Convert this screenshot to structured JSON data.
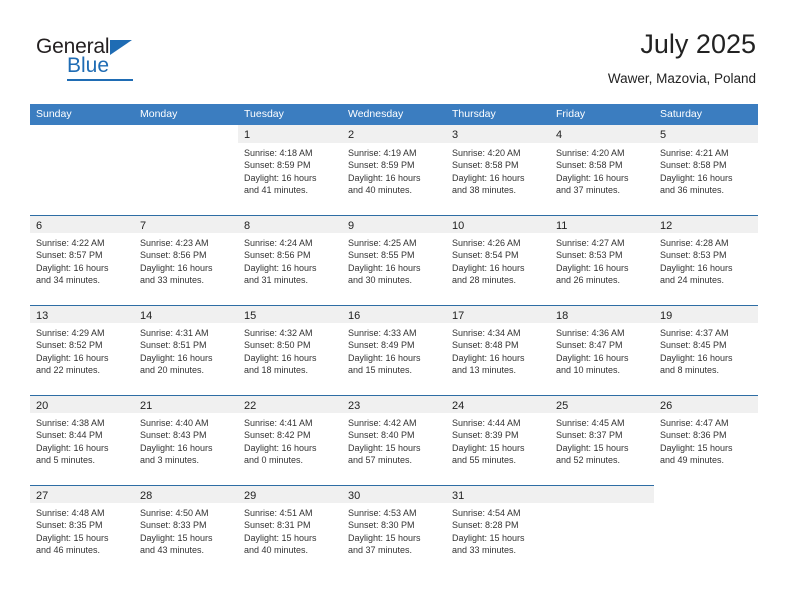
{
  "brand": {
    "line1": "General",
    "line2": "Blue",
    "triangle_color": "#1f6cb4"
  },
  "header": {
    "month_title": "July 2025",
    "location": "Wawer, Mazovia, Poland"
  },
  "theme": {
    "header_bar": "#3b7dc0",
    "row_divider": "#2e6da4",
    "num_band": "#f0f0f0",
    "text": "#333333"
  },
  "calendar": {
    "day_names": [
      "Sunday",
      "Monday",
      "Tuesday",
      "Wednesday",
      "Thursday",
      "Friday",
      "Saturday"
    ],
    "weeks": [
      [
        {
          "day": "",
          "empty": true
        },
        {
          "day": "",
          "empty": true
        },
        {
          "day": "1",
          "sunrise": "Sunrise: 4:18 AM",
          "sunset": "Sunset: 8:59 PM",
          "daylight1": "Daylight: 16 hours",
          "daylight2": "and 41 minutes."
        },
        {
          "day": "2",
          "sunrise": "Sunrise: 4:19 AM",
          "sunset": "Sunset: 8:59 PM",
          "daylight1": "Daylight: 16 hours",
          "daylight2": "and 40 minutes."
        },
        {
          "day": "3",
          "sunrise": "Sunrise: 4:20 AM",
          "sunset": "Sunset: 8:58 PM",
          "daylight1": "Daylight: 16 hours",
          "daylight2": "and 38 minutes."
        },
        {
          "day": "4",
          "sunrise": "Sunrise: 4:20 AM",
          "sunset": "Sunset: 8:58 PM",
          "daylight1": "Daylight: 16 hours",
          "daylight2": "and 37 minutes."
        },
        {
          "day": "5",
          "sunrise": "Sunrise: 4:21 AM",
          "sunset": "Sunset: 8:58 PM",
          "daylight1": "Daylight: 16 hours",
          "daylight2": "and 36 minutes."
        }
      ],
      [
        {
          "day": "6",
          "sunrise": "Sunrise: 4:22 AM",
          "sunset": "Sunset: 8:57 PM",
          "daylight1": "Daylight: 16 hours",
          "daylight2": "and 34 minutes."
        },
        {
          "day": "7",
          "sunrise": "Sunrise: 4:23 AM",
          "sunset": "Sunset: 8:56 PM",
          "daylight1": "Daylight: 16 hours",
          "daylight2": "and 33 minutes."
        },
        {
          "day": "8",
          "sunrise": "Sunrise: 4:24 AM",
          "sunset": "Sunset: 8:56 PM",
          "daylight1": "Daylight: 16 hours",
          "daylight2": "and 31 minutes."
        },
        {
          "day": "9",
          "sunrise": "Sunrise: 4:25 AM",
          "sunset": "Sunset: 8:55 PM",
          "daylight1": "Daylight: 16 hours",
          "daylight2": "and 30 minutes."
        },
        {
          "day": "10",
          "sunrise": "Sunrise: 4:26 AM",
          "sunset": "Sunset: 8:54 PM",
          "daylight1": "Daylight: 16 hours",
          "daylight2": "and 28 minutes."
        },
        {
          "day": "11",
          "sunrise": "Sunrise: 4:27 AM",
          "sunset": "Sunset: 8:53 PM",
          "daylight1": "Daylight: 16 hours",
          "daylight2": "and 26 minutes."
        },
        {
          "day": "12",
          "sunrise": "Sunrise: 4:28 AM",
          "sunset": "Sunset: 8:53 PM",
          "daylight1": "Daylight: 16 hours",
          "daylight2": "and 24 minutes."
        }
      ],
      [
        {
          "day": "13",
          "sunrise": "Sunrise: 4:29 AM",
          "sunset": "Sunset: 8:52 PM",
          "daylight1": "Daylight: 16 hours",
          "daylight2": "and 22 minutes."
        },
        {
          "day": "14",
          "sunrise": "Sunrise: 4:31 AM",
          "sunset": "Sunset: 8:51 PM",
          "daylight1": "Daylight: 16 hours",
          "daylight2": "and 20 minutes."
        },
        {
          "day": "15",
          "sunrise": "Sunrise: 4:32 AM",
          "sunset": "Sunset: 8:50 PM",
          "daylight1": "Daylight: 16 hours",
          "daylight2": "and 18 minutes."
        },
        {
          "day": "16",
          "sunrise": "Sunrise: 4:33 AM",
          "sunset": "Sunset: 8:49 PM",
          "daylight1": "Daylight: 16 hours",
          "daylight2": "and 15 minutes."
        },
        {
          "day": "17",
          "sunrise": "Sunrise: 4:34 AM",
          "sunset": "Sunset: 8:48 PM",
          "daylight1": "Daylight: 16 hours",
          "daylight2": "and 13 minutes."
        },
        {
          "day": "18",
          "sunrise": "Sunrise: 4:36 AM",
          "sunset": "Sunset: 8:47 PM",
          "daylight1": "Daylight: 16 hours",
          "daylight2": "and 10 minutes."
        },
        {
          "day": "19",
          "sunrise": "Sunrise: 4:37 AM",
          "sunset": "Sunset: 8:45 PM",
          "daylight1": "Daylight: 16 hours",
          "daylight2": "and 8 minutes."
        }
      ],
      [
        {
          "day": "20",
          "sunrise": "Sunrise: 4:38 AM",
          "sunset": "Sunset: 8:44 PM",
          "daylight1": "Daylight: 16 hours",
          "daylight2": "and 5 minutes."
        },
        {
          "day": "21",
          "sunrise": "Sunrise: 4:40 AM",
          "sunset": "Sunset: 8:43 PM",
          "daylight1": "Daylight: 16 hours",
          "daylight2": "and 3 minutes."
        },
        {
          "day": "22",
          "sunrise": "Sunrise: 4:41 AM",
          "sunset": "Sunset: 8:42 PM",
          "daylight1": "Daylight: 16 hours",
          "daylight2": "and 0 minutes."
        },
        {
          "day": "23",
          "sunrise": "Sunrise: 4:42 AM",
          "sunset": "Sunset: 8:40 PM",
          "daylight1": "Daylight: 15 hours",
          "daylight2": "and 57 minutes."
        },
        {
          "day": "24",
          "sunrise": "Sunrise: 4:44 AM",
          "sunset": "Sunset: 8:39 PM",
          "daylight1": "Daylight: 15 hours",
          "daylight2": "and 55 minutes."
        },
        {
          "day": "25",
          "sunrise": "Sunrise: 4:45 AM",
          "sunset": "Sunset: 8:37 PM",
          "daylight1": "Daylight: 15 hours",
          "daylight2": "and 52 minutes."
        },
        {
          "day": "26",
          "sunrise": "Sunrise: 4:47 AM",
          "sunset": "Sunset: 8:36 PM",
          "daylight1": "Daylight: 15 hours",
          "daylight2": "and 49 minutes."
        }
      ],
      [
        {
          "day": "27",
          "sunrise": "Sunrise: 4:48 AM",
          "sunset": "Sunset: 8:35 PM",
          "daylight1": "Daylight: 15 hours",
          "daylight2": "and 46 minutes."
        },
        {
          "day": "28",
          "sunrise": "Sunrise: 4:50 AM",
          "sunset": "Sunset: 8:33 PM",
          "daylight1": "Daylight: 15 hours",
          "daylight2": "and 43 minutes."
        },
        {
          "day": "29",
          "sunrise": "Sunrise: 4:51 AM",
          "sunset": "Sunset: 8:31 PM",
          "daylight1": "Daylight: 15 hours",
          "daylight2": "and 40 minutes."
        },
        {
          "day": "30",
          "sunrise": "Sunrise: 4:53 AM",
          "sunset": "Sunset: 8:30 PM",
          "daylight1": "Daylight: 15 hours",
          "daylight2": "and 37 minutes."
        },
        {
          "day": "31",
          "sunrise": "Sunrise: 4:54 AM",
          "sunset": "Sunset: 8:28 PM",
          "daylight1": "Daylight: 15 hours",
          "daylight2": "and 33 minutes."
        },
        {
          "day": "",
          "blank": true
        },
        {
          "day": "",
          "empty": true
        }
      ]
    ]
  }
}
